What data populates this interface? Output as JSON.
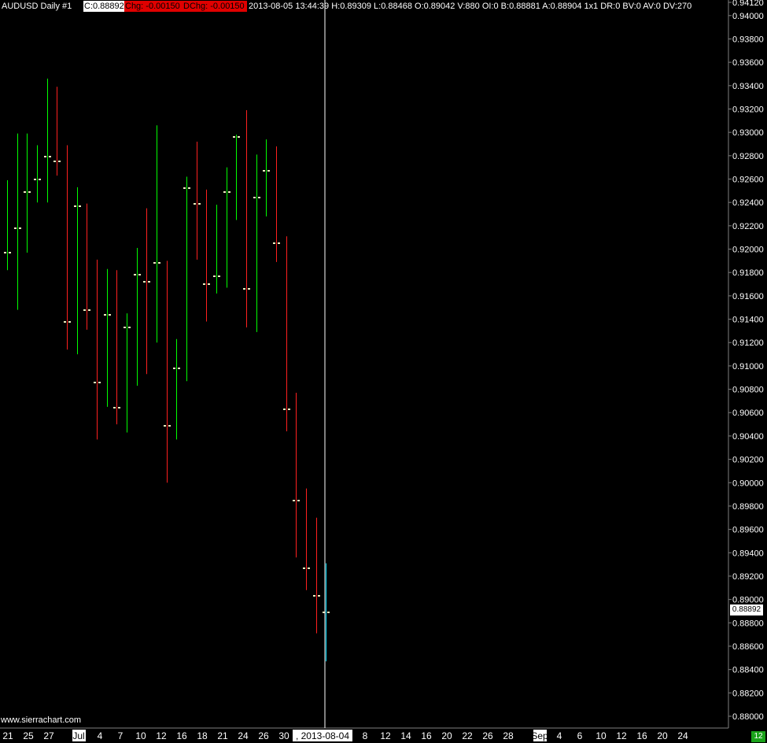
{
  "header": {
    "symbol_label": "AUDUSD  Daily  #1",
    "close_label": "C:0.88892",
    "chg_label": "Chg: -0.00150",
    "dchg_label": "DChg: -0.00150",
    "info_label": "2013-08-05 13:44:39 H:0.89309 L:0.88468 O:0.89042 V:880 OI:0 B:0.88881 A:0.88904 1x1 DR:0 BV:0 AV:0 DV:270"
  },
  "watermark": "www.sierrachart.com",
  "last_price_label": "0.88892",
  "bottom_right_badge": "12",
  "colors": {
    "up": "#00ff00",
    "down": "#ff2020",
    "neutral": "#00e0ff",
    "tick_mark": "#f0f0c0",
    "background": "#000000",
    "axis_text": "#ffffff",
    "cursor_line": "#ffffff"
  },
  "chart_data": {
    "type": "ohlc",
    "symbol": "AUDUSD",
    "timeframe": "Daily",
    "y_axis": {
      "ticks": [
        "0.88000",
        "0.88200",
        "0.88400",
        "0.88600",
        "0.88800",
        "0.89000",
        "0.89200",
        "0.89400",
        "0.89600",
        "0.89800",
        "0.90000",
        "0.90200",
        "0.90400",
        "0.90600",
        "0.90800",
        "0.91000",
        "0.91200",
        "0.91400",
        "0.91600",
        "0.91800",
        "0.92000",
        "0.92200",
        "0.92400",
        "0.92600",
        "0.92800",
        "0.93000",
        "0.93200",
        "0.93400",
        "0.93600",
        "0.93800",
        "0.94000",
        "0.94120"
      ],
      "ylim": [
        0.8789,
        0.9412
      ]
    },
    "x_axis": {
      "labels": [
        "21",
        "25",
        "27",
        "Jul",
        "4",
        "7",
        "10",
        "12",
        "16",
        "18",
        "21",
        "24",
        "26",
        "30",
        ", 2013-08-04",
        "8",
        "12",
        "14",
        "16",
        "20",
        "22",
        "26",
        "28",
        "Sep",
        "4",
        "6",
        "10",
        "12",
        "16",
        "20",
        "24"
      ],
      "highlighted_labels": [
        "Jul",
        "Sep"
      ],
      "cursor_label": ", 2013-08-04"
    },
    "bars": [
      {
        "date": "2013-06-20",
        "high": 0.9259,
        "low": 0.9182,
        "close": 0.9197,
        "dir": "up"
      },
      {
        "date": "2013-06-21",
        "high": 0.9299,
        "low": 0.9148,
        "close": 0.9218,
        "dir": "up"
      },
      {
        "date": "2013-06-24",
        "high": 0.9299,
        "low": 0.9197,
        "close": 0.9249,
        "dir": "up"
      },
      {
        "date": "2013-06-25",
        "high": 0.9289,
        "low": 0.924,
        "close": 0.926,
        "dir": "up"
      },
      {
        "date": "2013-06-26",
        "high": 0.9346,
        "low": 0.924,
        "close": 0.9279,
        "dir": "up"
      },
      {
        "date": "2013-06-27",
        "high": 0.9339,
        "low": 0.9263,
        "close": 0.9275,
        "dir": "down"
      },
      {
        "date": "2013-06-28",
        "high": 0.9289,
        "low": 0.9114,
        "close": 0.9138,
        "dir": "down"
      },
      {
        "date": "2013-07-01",
        "high": 0.9253,
        "low": 0.911,
        "close": 0.9237,
        "dir": "up"
      },
      {
        "date": "2013-07-02",
        "high": 0.9239,
        "low": 0.9131,
        "close": 0.9148,
        "dir": "down"
      },
      {
        "date": "2013-07-03",
        "high": 0.9191,
        "low": 0.9037,
        "close": 0.9086,
        "dir": "down"
      },
      {
        "date": "2013-07-04",
        "high": 0.9183,
        "low": 0.9065,
        "close": 0.9144,
        "dir": "up"
      },
      {
        "date": "2013-07-05",
        "high": 0.9182,
        "low": 0.905,
        "close": 0.9064,
        "dir": "down"
      },
      {
        "date": "2013-07-08",
        "high": 0.9145,
        "low": 0.9043,
        "close": 0.9133,
        "dir": "up"
      },
      {
        "date": "2013-07-09",
        "high": 0.9201,
        "low": 0.9083,
        "close": 0.9178,
        "dir": "up"
      },
      {
        "date": "2013-07-10",
        "high": 0.9235,
        "low": 0.9093,
        "close": 0.9172,
        "dir": "down"
      },
      {
        "date": "2013-07-11",
        "high": 0.9306,
        "low": 0.912,
        "close": 0.9188,
        "dir": "up"
      },
      {
        "date": "2013-07-12",
        "high": 0.919,
        "low": 0.9,
        "close": 0.9049,
        "dir": "down"
      },
      {
        "date": "2013-07-15",
        "high": 0.9123,
        "low": 0.9037,
        "close": 0.9098,
        "dir": "up"
      },
      {
        "date": "2013-07-16",
        "high": 0.9262,
        "low": 0.9087,
        "close": 0.9252,
        "dir": "up"
      },
      {
        "date": "2013-07-17",
        "high": 0.9292,
        "low": 0.9191,
        "close": 0.9239,
        "dir": "down"
      },
      {
        "date": "2013-07-18",
        "high": 0.9251,
        "low": 0.9138,
        "close": 0.917,
        "dir": "down"
      },
      {
        "date": "2013-07-19",
        "high": 0.9238,
        "low": 0.9162,
        "close": 0.9177,
        "dir": "up"
      },
      {
        "date": "2013-07-22",
        "high": 0.927,
        "low": 0.9167,
        "close": 0.9249,
        "dir": "up"
      },
      {
        "date": "2013-07-23",
        "high": 0.9298,
        "low": 0.9225,
        "close": 0.9296,
        "dir": "up"
      },
      {
        "date": "2013-07-24",
        "high": 0.9319,
        "low": 0.9133,
        "close": 0.9166,
        "dir": "down"
      },
      {
        "date": "2013-07-25",
        "high": 0.9281,
        "low": 0.9129,
        "close": 0.9244,
        "dir": "up"
      },
      {
        "date": "2013-07-26",
        "high": 0.9294,
        "low": 0.9228,
        "close": 0.9267,
        "dir": "up"
      },
      {
        "date": "2013-07-29",
        "high": 0.9288,
        "low": 0.9189,
        "close": 0.9205,
        "dir": "down"
      },
      {
        "date": "2013-07-30",
        "high": 0.9211,
        "low": 0.9044,
        "close": 0.9063,
        "dir": "down"
      },
      {
        "date": "2013-07-31",
        "high": 0.9077,
        "low": 0.8936,
        "close": 0.8985,
        "dir": "down"
      },
      {
        "date": "2013-08-01",
        "high": 0.8995,
        "low": 0.8908,
        "close": 0.8927,
        "dir": "down"
      },
      {
        "date": "2013-08-02",
        "high": 0.897,
        "low": 0.8871,
        "close": 0.8903,
        "dir": "down"
      },
      {
        "date": "2013-08-05",
        "high": 0.8931,
        "low": 0.8847,
        "close": 0.8889,
        "dir": "neutral"
      }
    ],
    "grid": false
  }
}
